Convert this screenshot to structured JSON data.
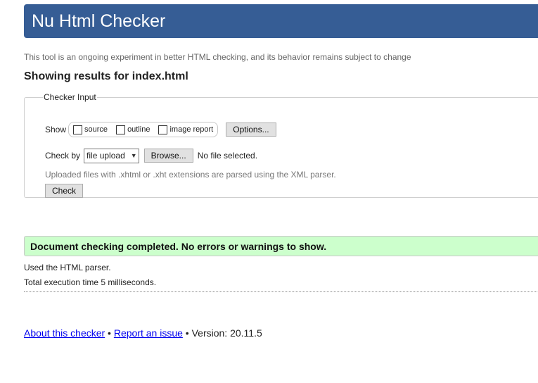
{
  "header": {
    "title": "Nu Html Checker"
  },
  "tagline": "This tool is an ongoing experiment in better HTML checking, and its behavior remains subject to change",
  "results_title": "Showing results for index.html",
  "checker_input": {
    "legend": "Checker Input",
    "show_label": "Show",
    "checkboxes": [
      {
        "label": "source",
        "checked": false
      },
      {
        "label": "outline",
        "checked": false
      },
      {
        "label": "image report",
        "checked": false
      }
    ],
    "options_button": "Options...",
    "check_by_label": "Check by",
    "check_by_selected": "file upload",
    "browse_button": "Browse...",
    "no_file": "No file selected.",
    "note": "Uploaded files with .xhtml or .xht extensions are parsed using the XML parser.",
    "check_button": "Check"
  },
  "result": {
    "message": "Document checking completed. No errors or warnings to show.",
    "background": "#ccffcc"
  },
  "info": {
    "parser": "Used the HTML parser.",
    "time": "Total execution time 5 milliseconds."
  },
  "footer": {
    "about_link": "About this checker",
    "separator1": " • ",
    "report_link": "Report an issue",
    "version_text": " • Version: 20.11.5"
  },
  "colors": {
    "header": "#365d95",
    "link": "#0000ee"
  }
}
